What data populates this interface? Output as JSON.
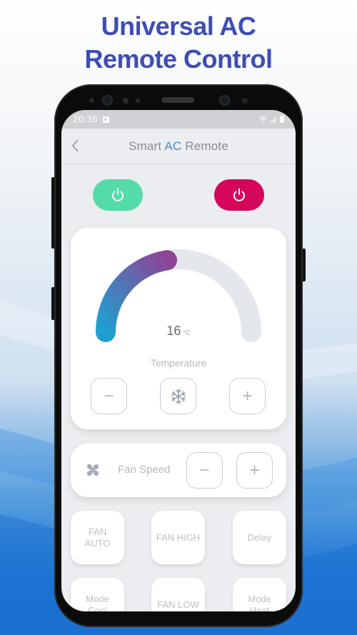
{
  "promo": {
    "title_line1": "Universal AC",
    "title_line2": "Remote Control"
  },
  "status_bar": {
    "time": "20:36",
    "icons": [
      "notification-icon",
      "wifi-icon",
      "signal-icon",
      "battery-icon"
    ]
  },
  "app_bar": {
    "back_icon": "chevron-left-icon",
    "title_prefix": "Smart ",
    "title_accent": "AC",
    "title_suffix": " Remote"
  },
  "power": {
    "on_icon": "power-icon",
    "off_icon": "power-icon",
    "on_color": "#54dba8",
    "off_color": "#d4075a"
  },
  "temperature": {
    "value": "16",
    "unit": "°C",
    "label": "Temperature",
    "gauge_fill_fraction": 0.45,
    "gradient_start": "#1f9fd0",
    "gradient_end": "#8d4596",
    "track_color": "#e4e7ec",
    "decrease_symbol": "−",
    "mode_icon": "snowflake-icon",
    "increase_symbol": "+"
  },
  "fan_speed": {
    "icon": "fan-icon",
    "label": "Fan Speed",
    "decrease_symbol": "−",
    "increase_symbol": "+"
  },
  "tiles": [
    {
      "line1": "FAN",
      "line2": "AUTO"
    },
    {
      "line1": "FAN HIGH",
      "line2": ""
    },
    {
      "line1": "Delay",
      "line2": ""
    },
    {
      "line1": "Mode",
      "line2": "Cool"
    },
    {
      "line1": "FAN LOW",
      "line2": ""
    },
    {
      "line1": "Mode",
      "line2": "Heat"
    }
  ]
}
